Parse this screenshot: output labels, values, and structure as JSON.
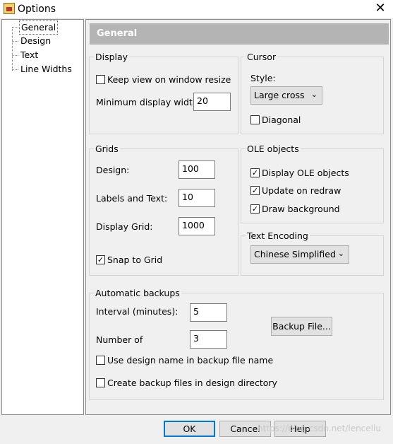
{
  "window": {
    "title": "Options",
    "close_glyph": "✕"
  },
  "tree": {
    "items": [
      "General",
      "Design",
      "Text",
      "Line Widths"
    ]
  },
  "header": {
    "title": "General"
  },
  "display": {
    "group_title": "Display",
    "keep_view_label": "Keep view on window resize",
    "keep_view_checked": false,
    "min_width_label": "Minimum display width:",
    "min_width_value": "20"
  },
  "cursor": {
    "group_title": "Cursor",
    "style_label": "Style:",
    "style_value": "Large cross",
    "diagonal_label": "Diagonal",
    "diagonal_checked": false
  },
  "grids": {
    "group_title": "Grids",
    "design_label": "Design:",
    "design_value": "100",
    "labels_text_label": "Labels and Text:",
    "labels_text_value": "10",
    "display_grid_label": "Display Grid:",
    "display_grid_value": "1000",
    "snap_label": "Snap to Grid",
    "snap_checked": true
  },
  "ole": {
    "group_title": "OLE objects",
    "display_label": "Display OLE objects",
    "update_label": "Update on redraw",
    "background_label": "Draw background",
    "display_checked": true,
    "update_checked": true,
    "background_checked": true
  },
  "encoding": {
    "group_title": "Text Encoding",
    "value": "Chinese Simplified"
  },
  "backups": {
    "group_title": "Automatic backups",
    "interval_label": "Interval (minutes):",
    "interval_value": "5",
    "number_label": "Number of",
    "number_value": "3",
    "backup_file_button": "Backup File...",
    "use_design_name_label": "Use design name in backup file name",
    "use_design_name_checked": false,
    "create_in_dir_label": "Create backup files in design directory",
    "create_in_dir_checked": false
  },
  "footer": {
    "ok": "OK",
    "cancel": "Cancel",
    "help": "Help"
  },
  "watermark": "https://blog.csdn.net/lenceliu",
  "glyphs": {
    "check": "✓",
    "dropdown": "⌄"
  }
}
